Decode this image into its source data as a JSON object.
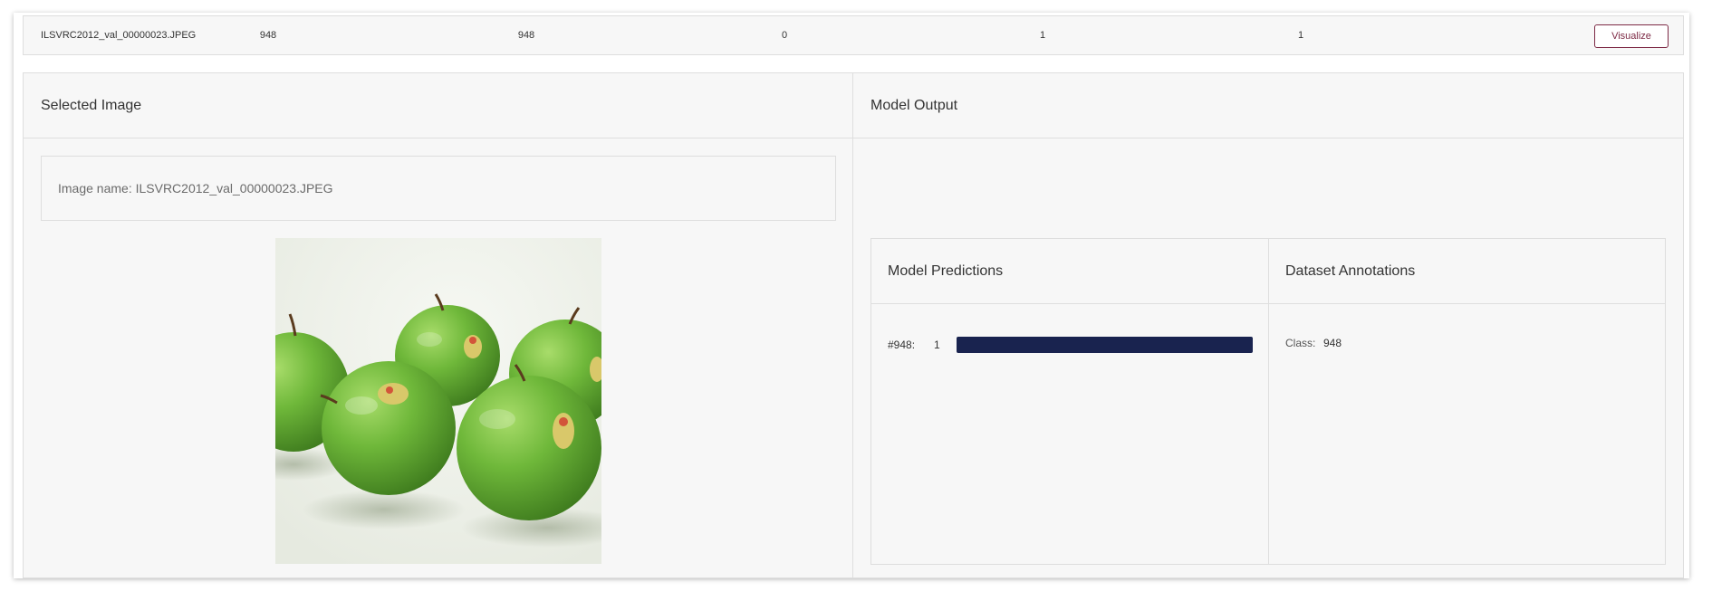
{
  "table_row": {
    "image_name": "ILSVRC2012_val_00000023.JPEG",
    "col2": "948",
    "col3": "948",
    "col4": "0",
    "col5": "1",
    "col6": "1",
    "visualize_label": "Visualize"
  },
  "selected_image": {
    "title": "Selected Image",
    "image_name_label": "Image name: ILSVRC2012_val_00000023.JPEG"
  },
  "model_output": {
    "title": "Model Output",
    "predictions": {
      "title": "Model Predictions",
      "items": [
        {
          "label": "#948:",
          "value": "1",
          "score": 1.0
        }
      ]
    },
    "annotations": {
      "title": "Dataset Annotations",
      "class_label": "Class:",
      "class_value": "948"
    }
  },
  "colors": {
    "accent": "#7d2a45",
    "bar": "#19234f",
    "panel_bg": "#f7f7f7",
    "border": "#dedede"
  }
}
